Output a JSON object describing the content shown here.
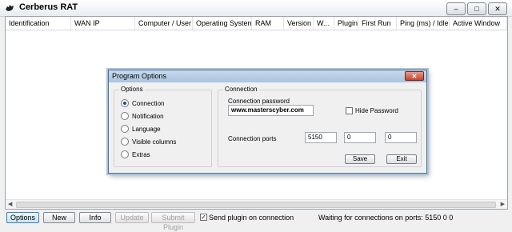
{
  "app": {
    "title": "Cerberus RAT"
  },
  "window_controls": {
    "minimize": "–",
    "maximize": "□",
    "close": "✕"
  },
  "table": {
    "columns": [
      "Identification",
      "WAN IP",
      "Computer / User",
      "Operating System",
      "RAM",
      "Version",
      "W...",
      "Plugin",
      "First Run",
      "Ping (ms) / Idle",
      "Active Window"
    ]
  },
  "bottom": {
    "options": "Options",
    "new": "New",
    "info": "Info",
    "update": "Update",
    "submit_plugin": "Submit Plugin",
    "send_plugin_label": "Send plugin on connection",
    "send_plugin_checked": true,
    "status": "Waiting for connections on ports: 5150 0 0"
  },
  "dialog": {
    "title": "Program Options",
    "options_group": "Options",
    "radios": [
      "Connection",
      "Notification",
      "Language",
      "Visible columns",
      "Extras"
    ],
    "selected": "Connection",
    "connection_group": "Connection",
    "password_label": "Connection password",
    "password_value": "www.masterscyber.com",
    "hide_password": "Hide Password",
    "hide_password_checked": false,
    "ports_label": "Connection ports",
    "ports": [
      "5150",
      "0",
      "0"
    ],
    "save": "Save",
    "exit": "Exit"
  }
}
